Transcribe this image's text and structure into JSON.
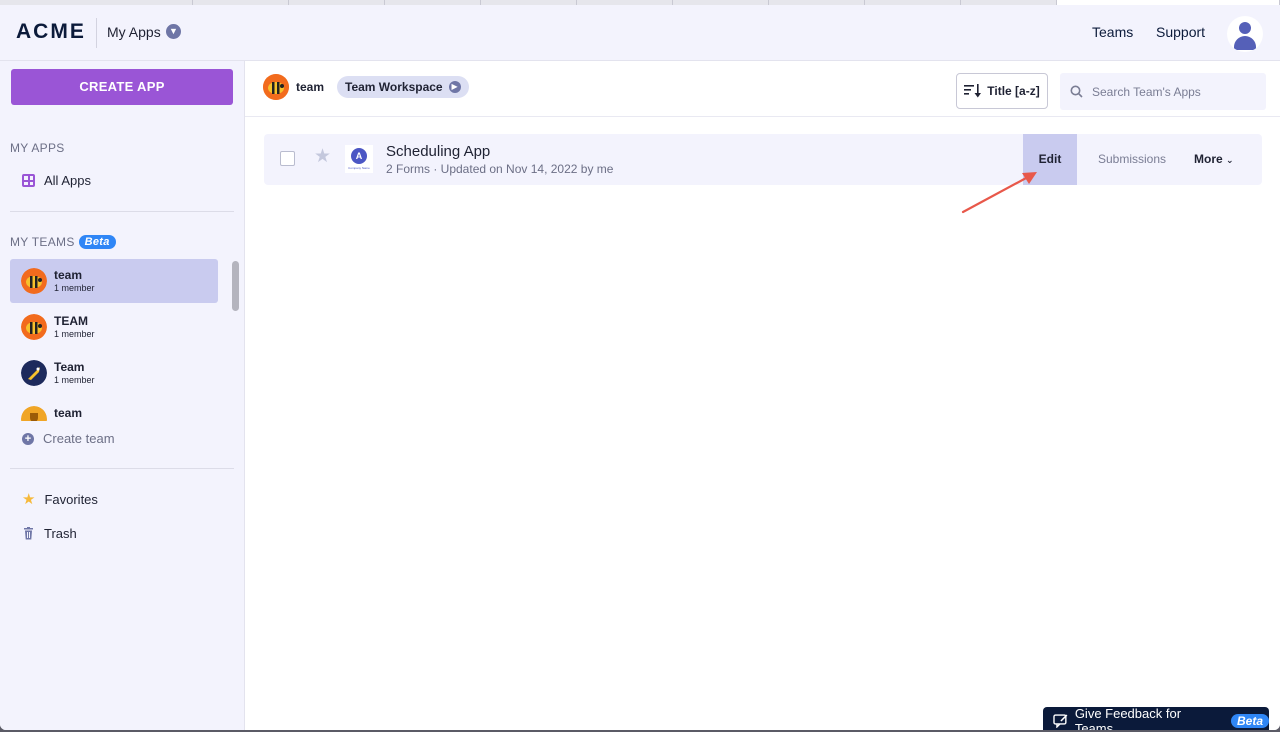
{
  "header": {
    "logo": "ACME",
    "section": "My Apps",
    "nav": [
      "Teams",
      "Support"
    ]
  },
  "sidebar": {
    "create_button": "CREATE APP",
    "my_apps_label": "MY APPS",
    "all_apps": "All Apps",
    "my_teams_label": "MY TEAMS",
    "beta": "Beta",
    "teams": [
      {
        "name": "team",
        "members": "1 member",
        "avatar_color": "#f26b1d"
      },
      {
        "name": "TEAM",
        "members": "1 member",
        "avatar_color": "#f26b1d"
      },
      {
        "name": "Team",
        "members": "1 member",
        "avatar_color": "#1d2a5c"
      },
      {
        "name": "team",
        "members": "",
        "avatar_color": "#f0a526"
      }
    ],
    "create_team": "Create team",
    "favorites": "Favorites",
    "trash": "Trash"
  },
  "workspace": {
    "team_name": "team",
    "pill": "Team Workspace",
    "sort_label": "Title [a-z]",
    "search_placeholder": "Search Team's Apps"
  },
  "apps": [
    {
      "title": "Scheduling App",
      "meta": "2 Forms · Updated on Nov 14, 2022 by me",
      "logo_letter": "A",
      "logo_caption": "Company Name",
      "actions": {
        "edit": "Edit",
        "submissions": "Submissions",
        "more": "More"
      }
    }
  ],
  "feedback": {
    "label": "Give Feedback for Teams",
    "beta": "Beta"
  },
  "colors": {
    "accent": "#9a55d6",
    "sidebar_bg": "#f3f3fd",
    "active": "#c9cbef",
    "annotation_arrow": "#e8584a"
  }
}
